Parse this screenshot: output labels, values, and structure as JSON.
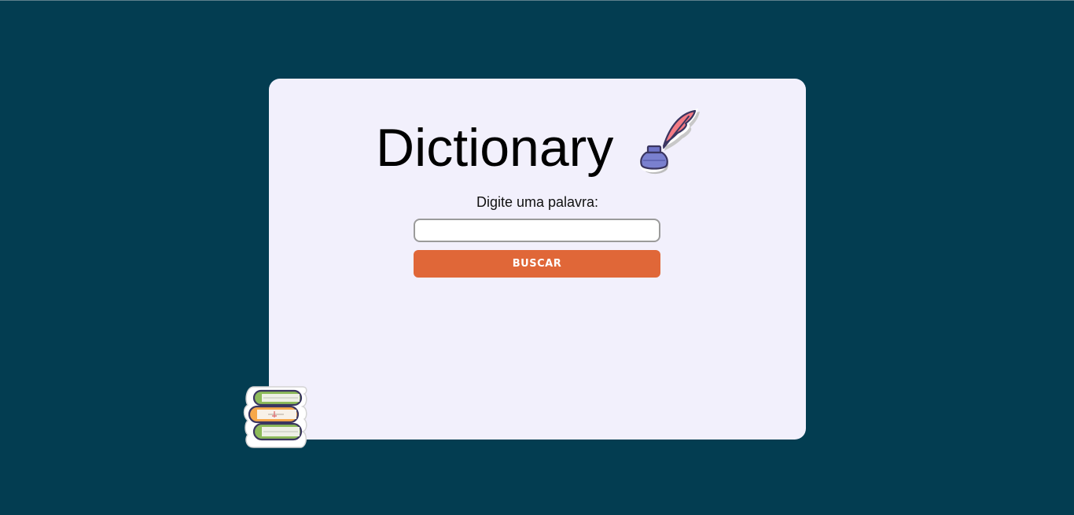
{
  "header": {
    "title": "Dictionary",
    "title_icon": "quill-inkwell-icon"
  },
  "search": {
    "label": "Digite uma palavra:",
    "value": "",
    "placeholder": "",
    "button_label": "BUSCAR"
  },
  "decorations": {
    "books_icon": "books-stack-icon"
  },
  "colors": {
    "background": "#033d51",
    "card": "#f2f0fc",
    "button": "#e06738",
    "button_text": "#ffffff"
  }
}
